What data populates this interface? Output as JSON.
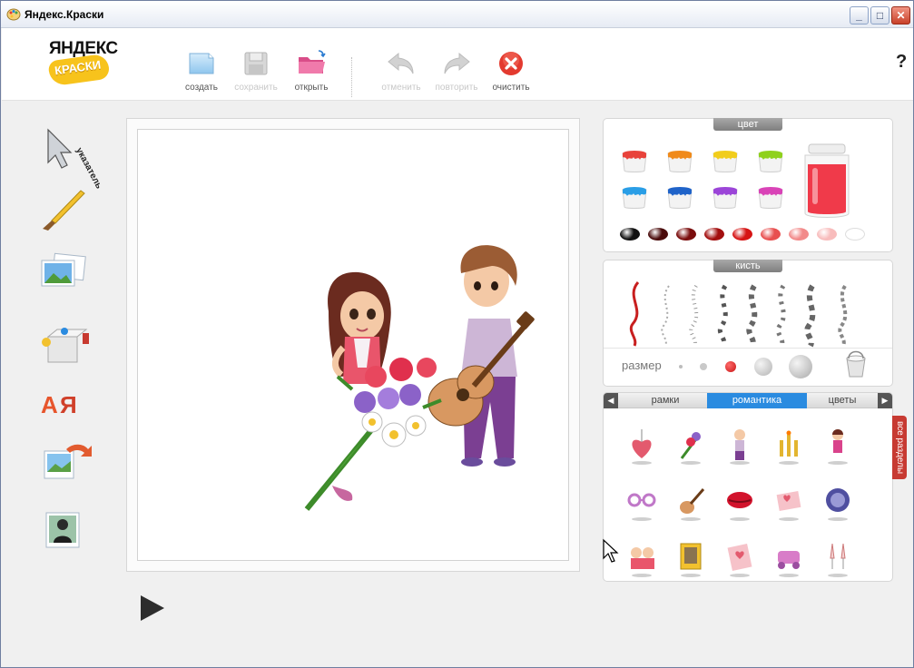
{
  "window": {
    "title": "Яндекс.Краски"
  },
  "logo": {
    "top": "ЯНДЕКС",
    "bottom": "КРАСКИ"
  },
  "toolbar": {
    "create": "создать",
    "save": "сохранить",
    "open": "открыть",
    "undo": "отменить",
    "redo": "повторить",
    "clear": "очистить",
    "help": "?"
  },
  "side_tools": {
    "pointer_label": "указатель"
  },
  "panels": {
    "color": {
      "title": "цвет",
      "paints": [
        "#e8433b",
        "#f08a1a",
        "#f1cd1c",
        "#8fd11d",
        "#2a9ee6",
        "#1f63c9",
        "#9b45d8",
        "#d943b7"
      ],
      "big_jar": "#f03a4a",
      "swatches": [
        "#111111",
        "#4a0b0b",
        "#7a0d0d",
        "#a30f0f",
        "#d61414",
        "#e85050",
        "#f28a8a",
        "#f8bcbc",
        "#ffffff"
      ]
    },
    "brush": {
      "title": "кисть",
      "size_label": "размер"
    },
    "stickers": {
      "categories": [
        "рамки",
        "романтика",
        "цветы"
      ],
      "active_category": "романтика",
      "all_sections": "все разделы"
    }
  },
  "colors": {
    "accent_blue": "#2a8be0",
    "tab_red": "#c73a32"
  }
}
